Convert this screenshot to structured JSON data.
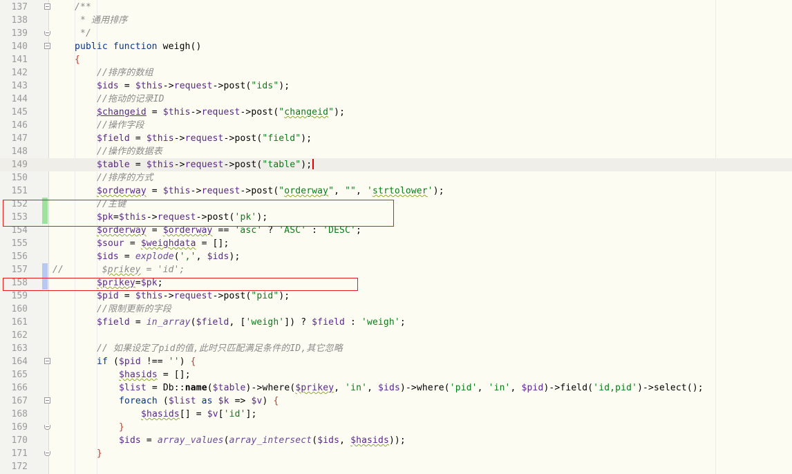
{
  "editor": {
    "current_line": 149,
    "colors": {
      "comment": "#8a8a8a",
      "keyword": "#00339b",
      "variable": "#5a2591",
      "string": "#067d17",
      "highlight_box": "#e41b1b",
      "added_marker": "#9fe29f",
      "modified_marker": "#b7c9f0"
    },
    "lines": [
      {
        "n": "137",
        "fold": "open",
        "indent": 4,
        "tokens": [
          {
            "t": "/**",
            "c": "cm"
          }
        ]
      },
      {
        "n": "138",
        "fold": "",
        "indent": 4,
        "tokens": [
          {
            "t": " * 通用排序",
            "c": "cm"
          }
        ]
      },
      {
        "n": "139",
        "fold": "end",
        "indent": 4,
        "tokens": [
          {
            "t": " */",
            "c": "cm"
          }
        ]
      },
      {
        "n": "140",
        "fold": "open",
        "indent": 4,
        "tokens": [
          {
            "t": "public ",
            "c": "kw"
          },
          {
            "t": "function ",
            "c": "kw"
          },
          {
            "t": "weigh()",
            "c": "fn"
          }
        ]
      },
      {
        "n": "141",
        "fold": "",
        "indent": 4,
        "tokens": [
          {
            "t": "{",
            "c": "punct"
          }
        ]
      },
      {
        "n": "142",
        "fold": "",
        "indent": 8,
        "tokens": [
          {
            "t": "//排序的数组",
            "c": "cm"
          }
        ]
      },
      {
        "n": "143",
        "fold": "",
        "indent": 8,
        "tokens": [
          {
            "t": "$ids",
            "c": "var"
          },
          {
            "t": " = ",
            "c": ""
          },
          {
            "t": "$this",
            "c": "var"
          },
          {
            "t": "->",
            "c": ""
          },
          {
            "t": "request",
            "c": "var"
          },
          {
            "t": "->",
            "c": ""
          },
          {
            "t": "post(",
            "c": ""
          },
          {
            "t": "\"ids\"",
            "c": "str"
          },
          {
            "t": ");",
            "c": ""
          }
        ]
      },
      {
        "n": "144",
        "fold": "",
        "indent": 8,
        "tokens": [
          {
            "t": "//拖动的记录ID",
            "c": "cm"
          }
        ]
      },
      {
        "n": "145",
        "fold": "",
        "indent": 8,
        "tokens": [
          {
            "t": "$changeid",
            "c": "var uline"
          },
          {
            "t": " = ",
            "c": ""
          },
          {
            "t": "$this",
            "c": "var"
          },
          {
            "t": "->",
            "c": ""
          },
          {
            "t": "request",
            "c": "var"
          },
          {
            "t": "->",
            "c": ""
          },
          {
            "t": "post(",
            "c": ""
          },
          {
            "t": "\"",
            "c": "str"
          },
          {
            "t": "changeid",
            "c": "str squig"
          },
          {
            "t": "\"",
            "c": "str"
          },
          {
            "t": ");",
            "c": ""
          }
        ]
      },
      {
        "n": "146",
        "fold": "",
        "indent": 8,
        "tokens": [
          {
            "t": "//操作字段",
            "c": "cm"
          }
        ]
      },
      {
        "n": "147",
        "fold": "",
        "indent": 8,
        "tokens": [
          {
            "t": "$field",
            "c": "var"
          },
          {
            "t": " = ",
            "c": ""
          },
          {
            "t": "$this",
            "c": "var"
          },
          {
            "t": "->",
            "c": ""
          },
          {
            "t": "request",
            "c": "var"
          },
          {
            "t": "->",
            "c": ""
          },
          {
            "t": "post(",
            "c": ""
          },
          {
            "t": "\"field\"",
            "c": "str"
          },
          {
            "t": ");",
            "c": ""
          }
        ]
      },
      {
        "n": "148",
        "fold": "",
        "indent": 8,
        "tokens": [
          {
            "t": "//操作的数据表",
            "c": "cm"
          }
        ]
      },
      {
        "n": "149",
        "fold": "",
        "indent": 8,
        "caret": true,
        "tokens": [
          {
            "t": "$table",
            "c": "var"
          },
          {
            "t": " = ",
            "c": ""
          },
          {
            "t": "$this",
            "c": "var"
          },
          {
            "t": "->",
            "c": ""
          },
          {
            "t": "request",
            "c": "var"
          },
          {
            "t": "->",
            "c": ""
          },
          {
            "t": "post(",
            "c": ""
          },
          {
            "t": "\"table\"",
            "c": "str"
          },
          {
            "t": ");",
            "c": ""
          }
        ]
      },
      {
        "n": "150",
        "fold": "",
        "indent": 8,
        "tokens": [
          {
            "t": "//排序的方式",
            "c": "cm"
          }
        ]
      },
      {
        "n": "151",
        "fold": "",
        "indent": 8,
        "tokens": [
          {
            "t": "$orderway",
            "c": "var squig"
          },
          {
            "t": " = ",
            "c": ""
          },
          {
            "t": "$this",
            "c": "var"
          },
          {
            "t": "->",
            "c": ""
          },
          {
            "t": "request",
            "c": "var"
          },
          {
            "t": "->",
            "c": ""
          },
          {
            "t": "post(",
            "c": ""
          },
          {
            "t": "\"",
            "c": "str"
          },
          {
            "t": "orderway",
            "c": "str squig"
          },
          {
            "t": "\"",
            "c": "str"
          },
          {
            "t": ", ",
            "c": ""
          },
          {
            "t": "\"\"",
            "c": "str"
          },
          {
            "t": ", ",
            "c": ""
          },
          {
            "t": "'",
            "c": "str"
          },
          {
            "t": "strtolower",
            "c": "str squig"
          },
          {
            "t": "'",
            "c": "str"
          },
          {
            "t": ");",
            "c": ""
          }
        ]
      },
      {
        "n": "152",
        "fold": "",
        "indent": 8,
        "change": "added",
        "tokens": [
          {
            "t": "//主键",
            "c": "cm"
          }
        ]
      },
      {
        "n": "153",
        "fold": "",
        "indent": 8,
        "change": "added",
        "tokens": [
          {
            "t": "$pk",
            "c": "var"
          },
          {
            "t": "=",
            "c": ""
          },
          {
            "t": "$this",
            "c": "var"
          },
          {
            "t": "->",
            "c": ""
          },
          {
            "t": "request",
            "c": "var"
          },
          {
            "t": "->",
            "c": ""
          },
          {
            "t": "post(",
            "c": ""
          },
          {
            "t": "'pk'",
            "c": "str"
          },
          {
            "t": ");",
            "c": ""
          }
        ]
      },
      {
        "n": "154",
        "fold": "",
        "indent": 8,
        "tokens": [
          {
            "t": "$orderway",
            "c": "var squig"
          },
          {
            "t": " = ",
            "c": ""
          },
          {
            "t": "$orderway",
            "c": "var squig"
          },
          {
            "t": " == ",
            "c": ""
          },
          {
            "t": "'asc'",
            "c": "str"
          },
          {
            "t": " ? ",
            "c": ""
          },
          {
            "t": "'ASC'",
            "c": "str"
          },
          {
            "t": " : ",
            "c": ""
          },
          {
            "t": "'DESC'",
            "c": "str"
          },
          {
            "t": ";",
            "c": ""
          }
        ]
      },
      {
        "n": "155",
        "fold": "",
        "indent": 8,
        "tokens": [
          {
            "t": "$sour",
            "c": "var"
          },
          {
            "t": " = ",
            "c": ""
          },
          {
            "t": "$weighdata",
            "c": "var squig"
          },
          {
            "t": " = [];",
            "c": ""
          }
        ]
      },
      {
        "n": "156",
        "fold": "",
        "indent": 8,
        "tokens": [
          {
            "t": "$ids",
            "c": "var"
          },
          {
            "t": " = ",
            "c": ""
          },
          {
            "t": "explode",
            "c": "call"
          },
          {
            "t": "(",
            "c": ""
          },
          {
            "t": "','",
            "c": "str"
          },
          {
            "t": ", ",
            "c": ""
          },
          {
            "t": "$ids",
            "c": "var"
          },
          {
            "t": ");",
            "c": ""
          }
        ]
      },
      {
        "n": "157",
        "fold": "",
        "indent": 0,
        "change": "modified",
        "tokens": [
          {
            "t": "//       ",
            "c": "cm"
          },
          {
            "t": "$",
            "c": "cm"
          },
          {
            "t": "prikey",
            "c": "cm squig"
          },
          {
            "t": " = 'id';",
            "c": "cm"
          }
        ]
      },
      {
        "n": "158",
        "fold": "",
        "indent": 8,
        "change": "modified",
        "tokens": [
          {
            "t": "$prikey",
            "c": "var squig"
          },
          {
            "t": "=",
            "c": ""
          },
          {
            "t": "$pk",
            "c": "var"
          },
          {
            "t": ";",
            "c": ""
          }
        ]
      },
      {
        "n": "159",
        "fold": "",
        "indent": 8,
        "tokens": [
          {
            "t": "$pid",
            "c": "var"
          },
          {
            "t": " = ",
            "c": ""
          },
          {
            "t": "$this",
            "c": "var"
          },
          {
            "t": "->",
            "c": ""
          },
          {
            "t": "request",
            "c": "var"
          },
          {
            "t": "->",
            "c": ""
          },
          {
            "t": "post(",
            "c": ""
          },
          {
            "t": "\"pid\"",
            "c": "str"
          },
          {
            "t": ");",
            "c": ""
          }
        ]
      },
      {
        "n": "160",
        "fold": "",
        "indent": 8,
        "tokens": [
          {
            "t": "//限制更新的字段",
            "c": "cm"
          }
        ]
      },
      {
        "n": "161",
        "fold": "",
        "indent": 8,
        "tokens": [
          {
            "t": "$field",
            "c": "var"
          },
          {
            "t": " = ",
            "c": ""
          },
          {
            "t": "in_array",
            "c": "call"
          },
          {
            "t": "(",
            "c": ""
          },
          {
            "t": "$field",
            "c": "var"
          },
          {
            "t": ", [",
            "c": ""
          },
          {
            "t": "'weigh'",
            "c": "str"
          },
          {
            "t": "]) ? ",
            "c": ""
          },
          {
            "t": "$field",
            "c": "var"
          },
          {
            "t": " : ",
            "c": ""
          },
          {
            "t": "'weigh'",
            "c": "str"
          },
          {
            "t": ";",
            "c": ""
          }
        ]
      },
      {
        "n": "162",
        "fold": "",
        "indent": 8,
        "tokens": []
      },
      {
        "n": "163",
        "fold": "",
        "indent": 8,
        "tokens": [
          {
            "t": "// 如果设定了pid的值,此时只匹配满足条件的ID,其它忽略",
            "c": "cm"
          }
        ]
      },
      {
        "n": "164",
        "fold": "open",
        "indent": 8,
        "tokens": [
          {
            "t": "if ",
            "c": "kw"
          },
          {
            "t": "(",
            "c": ""
          },
          {
            "t": "$pid",
            "c": "var"
          },
          {
            "t": " !== ",
            "c": ""
          },
          {
            "t": "''",
            "c": "str"
          },
          {
            "t": ") ",
            "c": ""
          },
          {
            "t": "{",
            "c": "punct"
          }
        ]
      },
      {
        "n": "165",
        "fold": "",
        "indent": 12,
        "tokens": [
          {
            "t": "$hasids",
            "c": "var squig"
          },
          {
            "t": " = [];",
            "c": ""
          }
        ]
      },
      {
        "n": "166",
        "fold": "",
        "indent": 12,
        "tokens": [
          {
            "t": "$list",
            "c": "var"
          },
          {
            "t": " = ",
            "c": ""
          },
          {
            "t": "Db",
            "c": "fn"
          },
          {
            "t": "::",
            "c": ""
          },
          {
            "t": "name",
            "c": "bold"
          },
          {
            "t": "(",
            "c": ""
          },
          {
            "t": "$table",
            "c": "var"
          },
          {
            "t": ")->where(",
            "c": ""
          },
          {
            "t": "$prikey",
            "c": "var squig"
          },
          {
            "t": ", ",
            "c": ""
          },
          {
            "t": "'in'",
            "c": "str"
          },
          {
            "t": ", ",
            "c": ""
          },
          {
            "t": "$ids",
            "c": "var"
          },
          {
            "t": ")->where(",
            "c": ""
          },
          {
            "t": "'pid'",
            "c": "str"
          },
          {
            "t": ", ",
            "c": ""
          },
          {
            "t": "'in'",
            "c": "str"
          },
          {
            "t": ", ",
            "c": ""
          },
          {
            "t": "$pid",
            "c": "var"
          },
          {
            "t": ")->field(",
            "c": ""
          },
          {
            "t": "'id,pid'",
            "c": "str"
          },
          {
            "t": ")->select();",
            "c": ""
          }
        ]
      },
      {
        "n": "167",
        "fold": "open",
        "indent": 12,
        "tokens": [
          {
            "t": "foreach ",
            "c": "kw"
          },
          {
            "t": "(",
            "c": ""
          },
          {
            "t": "$list",
            "c": "var"
          },
          {
            "t": " as ",
            "c": "kw"
          },
          {
            "t": "$k",
            "c": "var"
          },
          {
            "t": " => ",
            "c": ""
          },
          {
            "t": "$v",
            "c": "var"
          },
          {
            "t": ") ",
            "c": ""
          },
          {
            "t": "{",
            "c": "punct"
          }
        ]
      },
      {
        "n": "168",
        "fold": "",
        "indent": 16,
        "tokens": [
          {
            "t": "$hasids",
            "c": "var squig"
          },
          {
            "t": "[] = ",
            "c": ""
          },
          {
            "t": "$v",
            "c": "var"
          },
          {
            "t": "[",
            "c": ""
          },
          {
            "t": "'id'",
            "c": "str"
          },
          {
            "t": "];",
            "c": ""
          }
        ]
      },
      {
        "n": "169",
        "fold": "end",
        "indent": 12,
        "tokens": [
          {
            "t": "}",
            "c": "punct"
          }
        ]
      },
      {
        "n": "170",
        "fold": "",
        "indent": 12,
        "tokens": [
          {
            "t": "$ids",
            "c": "var"
          },
          {
            "t": " = ",
            "c": ""
          },
          {
            "t": "array_values",
            "c": "call"
          },
          {
            "t": "(",
            "c": ""
          },
          {
            "t": "array_intersect",
            "c": "call"
          },
          {
            "t": "(",
            "c": ""
          },
          {
            "t": "$ids",
            "c": "var"
          },
          {
            "t": ", ",
            "c": ""
          },
          {
            "t": "$hasids",
            "c": "var squig"
          },
          {
            "t": "));",
            "c": ""
          }
        ]
      },
      {
        "n": "171",
        "fold": "end",
        "indent": 8,
        "tokens": [
          {
            "t": "}",
            "c": "punct"
          }
        ]
      },
      {
        "n": "172",
        "fold": "",
        "indent": 0,
        "tokens": []
      }
    ]
  }
}
